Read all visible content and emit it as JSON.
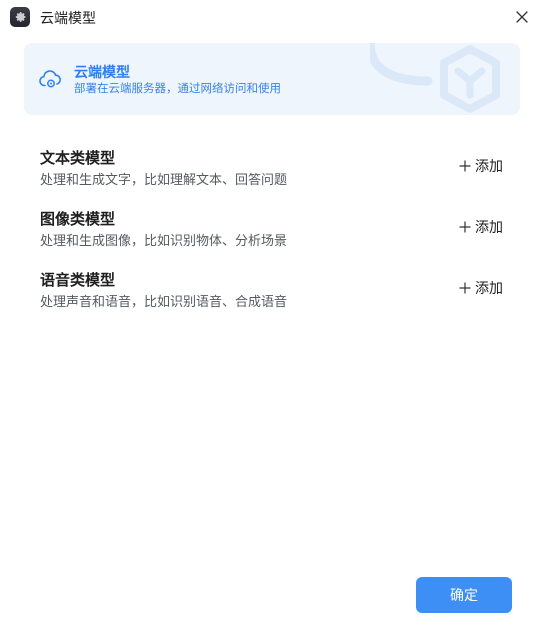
{
  "window": {
    "title": "云端模型",
    "icons": {
      "app": "gear-icon",
      "close": "close-icon"
    }
  },
  "banner": {
    "title": "云端模型",
    "subtitle": "部署在云端服务器，通过网络访问和使用",
    "icon": "cloud-gear-icon",
    "accent": "#2f7ff0",
    "background": "#eef5fd"
  },
  "models": [
    {
      "title": "文本类模型",
      "description": "处理和生成文字，比如理解文本、回答问题",
      "add_label": "添加"
    },
    {
      "title": "图像类模型",
      "description": "处理和生成图像，比如识别物体、分析场景",
      "add_label": "添加"
    },
    {
      "title": "语音类模型",
      "description": "处理声音和语音，比如识别语音、合成语音",
      "add_label": "添加"
    }
  ],
  "footer": {
    "confirm_label": "确定",
    "confirm_color": "#3d8ff5"
  }
}
